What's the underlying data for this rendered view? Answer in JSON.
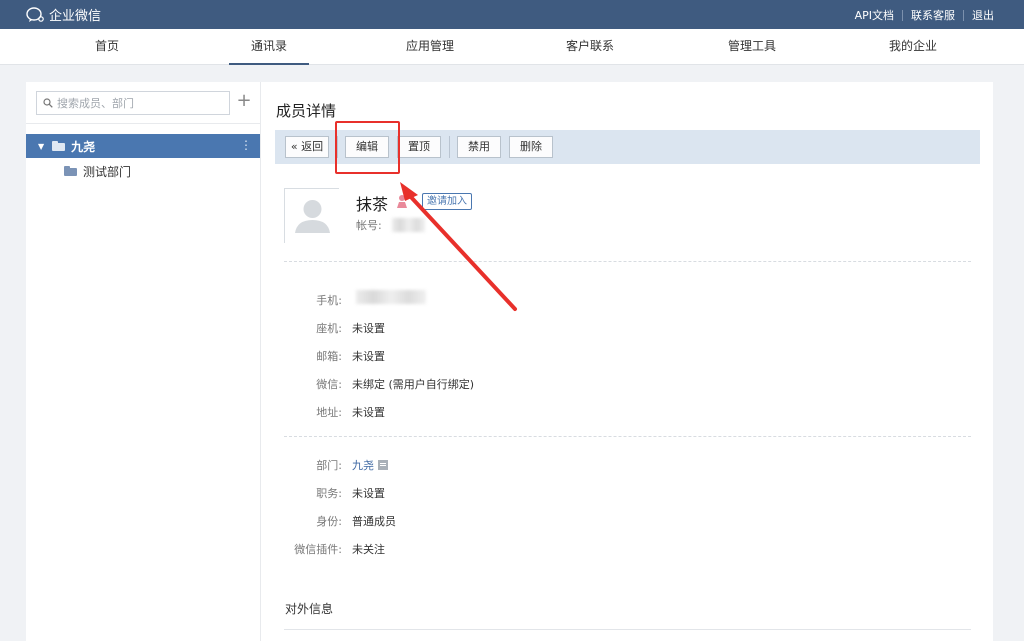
{
  "topbar": {
    "logo_text": "企业微信",
    "links": [
      {
        "label": "API文档"
      },
      {
        "label": "联系客服"
      },
      {
        "label": "退出"
      }
    ]
  },
  "nav": {
    "items": [
      {
        "label": "首页",
        "active": false
      },
      {
        "label": "通讯录",
        "active": true
      },
      {
        "label": "应用管理",
        "active": false
      },
      {
        "label": "客户联系",
        "active": false
      },
      {
        "label": "管理工具",
        "active": false
      },
      {
        "label": "我的企业",
        "active": false
      }
    ]
  },
  "sidebar": {
    "search_placeholder": "搜索成员、部门",
    "add_icon": "plus-icon",
    "tree": {
      "root_label": "九尧",
      "children": [
        {
          "label": "测试部门"
        }
      ]
    }
  },
  "main": {
    "title": "成员详情",
    "toolbar": {
      "back_label": "« 返回",
      "edit_label": "编辑",
      "pin_label": "置顶",
      "disable_label": "禁用",
      "delete_label": "删除"
    },
    "profile": {
      "name": "抹茶",
      "invite_label": "邀请加入",
      "account_label": "帐号:"
    },
    "contact": [
      {
        "label": "手机:",
        "value": ""
      },
      {
        "label": "座机:",
        "value": "未设置"
      },
      {
        "label": "邮箱:",
        "value": "未设置"
      },
      {
        "label": "微信:",
        "value": "未绑定 (需用户自行绑定)"
      },
      {
        "label": "地址:",
        "value": "未设置"
      }
    ],
    "org": [
      {
        "label": "部门:",
        "value": "九尧"
      },
      {
        "label": "职务:",
        "value": "未设置"
      },
      {
        "label": "身份:",
        "value": "普通成员"
      },
      {
        "label": "微信插件:",
        "value": "未关注"
      }
    ],
    "external_section_title": "对外信息"
  },
  "colors": {
    "topbar": "#3f5b80",
    "accent": "#4a77b0",
    "annotation": "#e8302b"
  }
}
